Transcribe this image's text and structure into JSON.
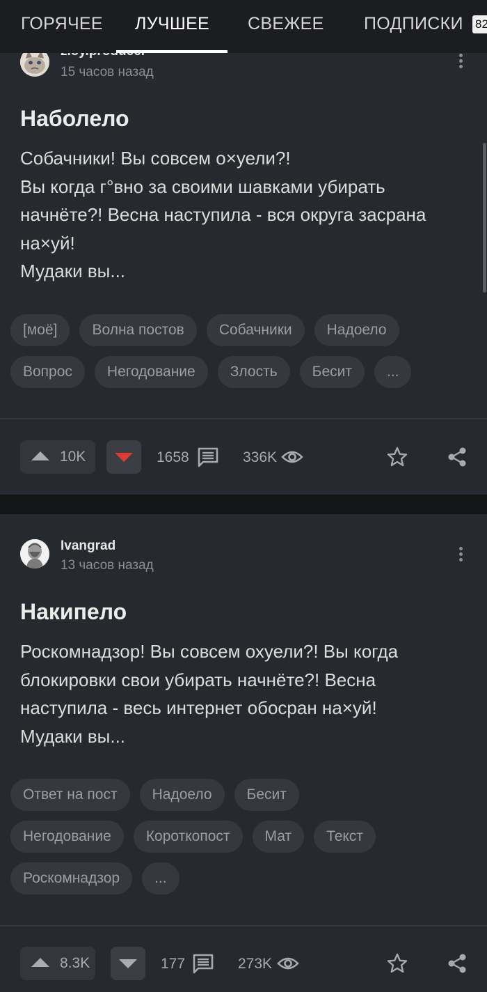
{
  "tabs": [
    {
      "label": "ГОРЯЧЕЕ"
    },
    {
      "label": "ЛУЧШЕЕ"
    },
    {
      "label": "СВЕЖЕЕ"
    },
    {
      "label": "ПОДПИСКИ"
    }
  ],
  "notification_badge": "82",
  "colors": {
    "background": "#26292d",
    "topbar": "#1b1d20",
    "tag_bg": "#35383c",
    "downvote_active": "#e03b33"
  },
  "posts": [
    {
      "author": "zloy.producer",
      "time": "15 часов назад",
      "title": "Наболело",
      "body_lines": [
        "Собачники! Вы совсем о×уели?!",
        "Вы когда г°вно за своими шавками убирать",
        "начнёте?! Весна наступила - вся округа засрана",
        "на×уй!",
        "Мудаки вы..."
      ],
      "tags": [
        [
          "[моё]",
          "Волна постов",
          "Собачники",
          "Надоело"
        ],
        [
          "Вопрос",
          "Негодование",
          "Злость",
          "Бесит",
          "..."
        ]
      ],
      "rating": "10K",
      "downvoted": true,
      "comments": "1658",
      "views": "336K"
    },
    {
      "author": "Ivangrad",
      "time": "13 часов назад",
      "title": "Накипело",
      "body_lines": [
        "Роскомнадзор! Вы совсем охуели?! Вы когда",
        "блокировки свои убирать начнёте?! Весна",
        "наступила - весь интернет обосран на×уй!",
        "Мудаки вы..."
      ],
      "tags": [
        [
          "Ответ на пост",
          "Надоело",
          "Бесит"
        ],
        [
          "Негодование",
          "Короткопост",
          "Мат",
          "Текст"
        ],
        [
          "Роскомнадзор",
          "..."
        ]
      ],
      "rating": "8.3K",
      "downvoted": false,
      "comments": "177",
      "views": "273K"
    }
  ]
}
